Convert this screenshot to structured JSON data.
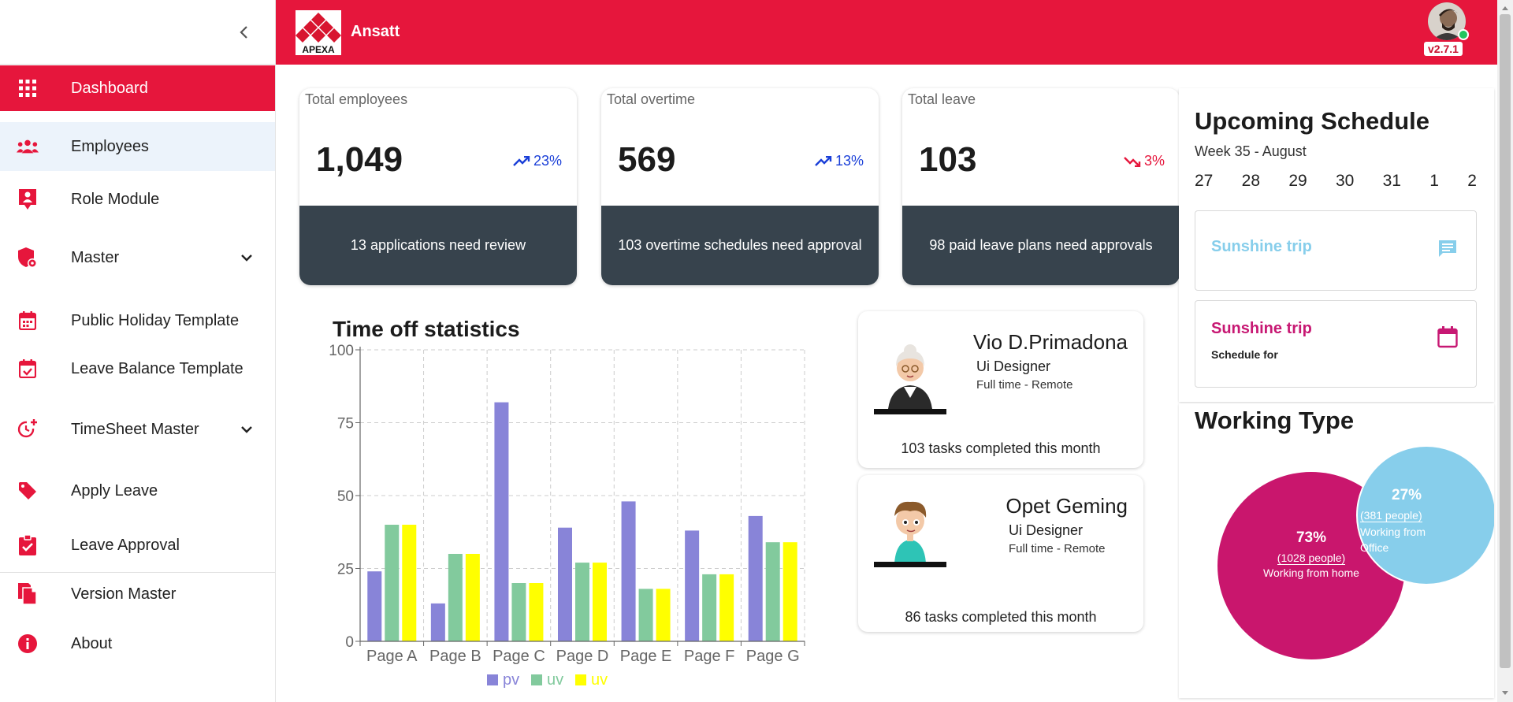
{
  "sidebar": {
    "items": [
      {
        "label": "Dashboard",
        "icon": "grid-icon"
      },
      {
        "label": "Employees",
        "icon": "people-icon"
      },
      {
        "label": "Role Module",
        "icon": "person-badge-icon"
      },
      {
        "label": "Master",
        "icon": "shield-gear-icon"
      },
      {
        "label": "Public Holiday Template",
        "icon": "calendar-icon"
      },
      {
        "label": "Leave Balance Template",
        "icon": "calendar-check-icon"
      },
      {
        "label": "TimeSheet Master",
        "icon": "clock-plus-icon"
      },
      {
        "label": "Apply Leave",
        "icon": "tag-icon"
      },
      {
        "label": "Leave Approval",
        "icon": "clipboard-check-icon"
      },
      {
        "label": "Version Master",
        "icon": "documents-icon"
      },
      {
        "label": "About",
        "icon": "info-icon"
      }
    ]
  },
  "header": {
    "logo_text": "APEXA",
    "brand": "Ansatt",
    "version": "v2.7.1"
  },
  "stats": [
    {
      "title": "Total employees",
      "value": "1,049",
      "trend": "23%",
      "direction": "up",
      "footer": "13 applications need review"
    },
    {
      "title": "Total overtime",
      "value": "569",
      "trend": "13%",
      "direction": "up",
      "footer": "103 overtime schedules need approval"
    },
    {
      "title": "Total leave",
      "value": "103",
      "trend": "3%",
      "direction": "down",
      "footer": "98 paid leave plans need approvals"
    }
  ],
  "chart_data": {
    "type": "bar",
    "title": "Time off statistics",
    "categories": [
      "Page A",
      "Page B",
      "Page C",
      "Page D",
      "Page E",
      "Page F",
      "Page G"
    ],
    "series": [
      {
        "name": "pv",
        "color": "#8884d8",
        "values": [
          24,
          13,
          82,
          39,
          48,
          38,
          43
        ]
      },
      {
        "name": "uv",
        "color": "#82ca9d",
        "values": [
          40,
          30,
          20,
          27,
          18,
          23,
          34
        ]
      },
      {
        "name": "uv",
        "color": "#ffff00",
        "values": [
          40,
          30,
          20,
          27,
          18,
          23,
          34
        ]
      }
    ],
    "ylim": [
      0,
      100
    ],
    "yticks": [
      0,
      25,
      50,
      75,
      100
    ],
    "grid": true,
    "legend": "bottom"
  },
  "people": [
    {
      "name": "Vio D.Primadona",
      "role": "Ui Designer",
      "type": "Full time - Remote",
      "tasks": "103 tasks completed this month",
      "avatar": "old-lady-avatar"
    },
    {
      "name": "Opet Geming",
      "role": "Ui Designer",
      "type": "Full time - Remote",
      "tasks": "86 tasks completed this month",
      "avatar": "boy-avatar"
    }
  ],
  "schedule": {
    "title": "Upcoming Schedule",
    "week": "Week 35 - August",
    "days": [
      "27",
      "28",
      "29",
      "30",
      "31",
      "1",
      "2"
    ],
    "events": [
      {
        "title": "Sunshine trip",
        "subtitle": "",
        "color": "#87ceeb",
        "icon": "chat-icon"
      },
      {
        "title": "Sunshine trip",
        "subtitle": "Schedule for",
        "color": "#c71873",
        "icon": "calendar-icon"
      }
    ]
  },
  "working_type": {
    "title": "Working Type",
    "segments": [
      {
        "percent": "73%",
        "people": "(1028 people)",
        "label": "Working from home",
        "color": "#c9166d"
      },
      {
        "percent": "27%",
        "people": "(381 people)",
        "label": "Working from Office",
        "color": "#87ceeb"
      }
    ]
  }
}
